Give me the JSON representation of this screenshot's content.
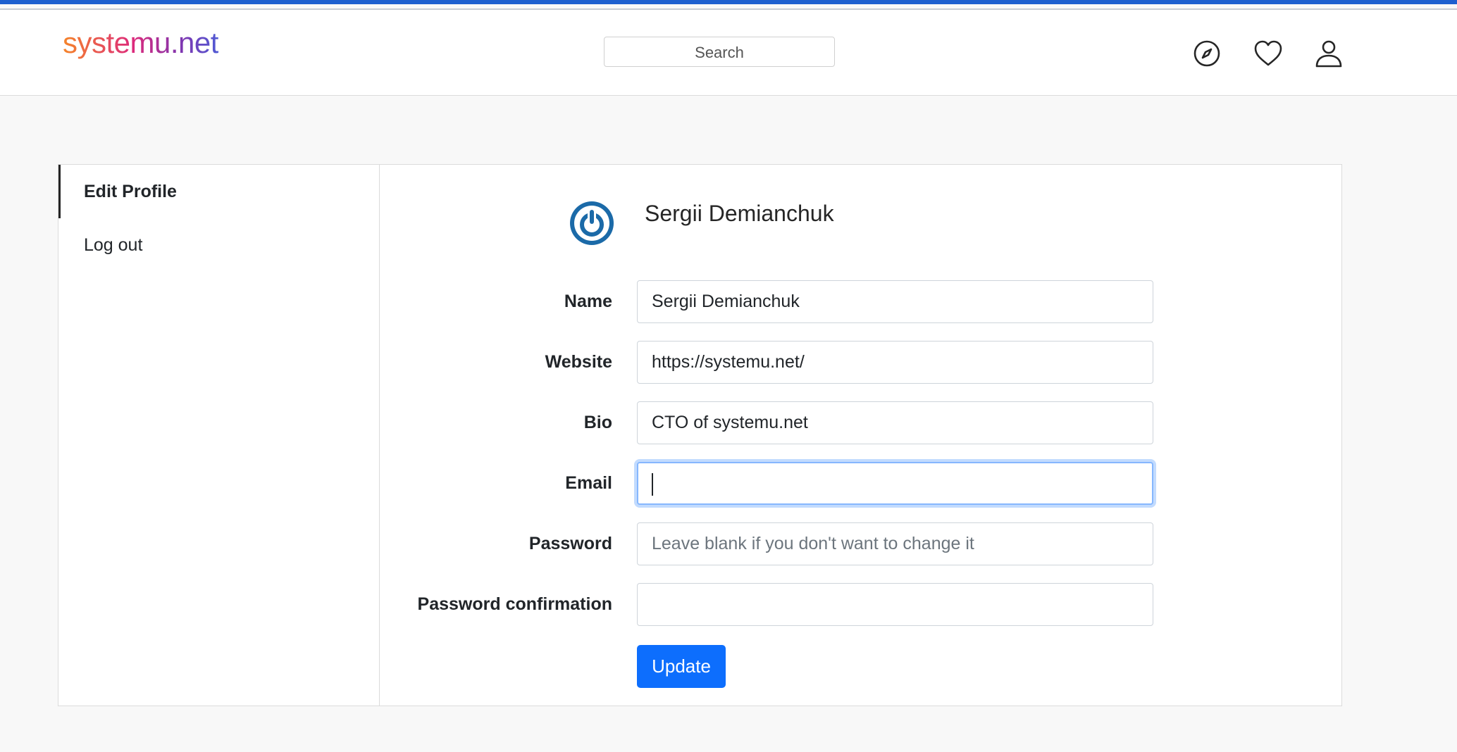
{
  "header": {
    "logo": "systemu.net",
    "search_placeholder": "Search",
    "icons": [
      "compass-icon",
      "heart-icon",
      "user-icon"
    ]
  },
  "sidebar": {
    "items": [
      {
        "label": "Edit Profile",
        "active": true
      },
      {
        "label": "Log out",
        "active": false
      }
    ]
  },
  "profile": {
    "display_name": "Sergii Demianchuk",
    "avatar_icon": "power-icon"
  },
  "form": {
    "name_label": "Name",
    "name_value": "Sergii Demianchuk",
    "website_label": "Website",
    "website_value": "https://systemu.net/",
    "bio_label": "Bio",
    "bio_value": "CTO of systemu.net",
    "email_label": "Email",
    "email_value": "",
    "password_label": "Password",
    "password_placeholder": "Leave blank if you don't want to change it",
    "password_confirmation_label": "Password confirmation",
    "password_confirmation_value": "",
    "submit_label": "Update"
  },
  "colors": {
    "primary": "#0d6efd",
    "focus_ring": "#86b7fe",
    "top_bar": "#1d5fcf",
    "avatar": "#1b6aa8"
  }
}
